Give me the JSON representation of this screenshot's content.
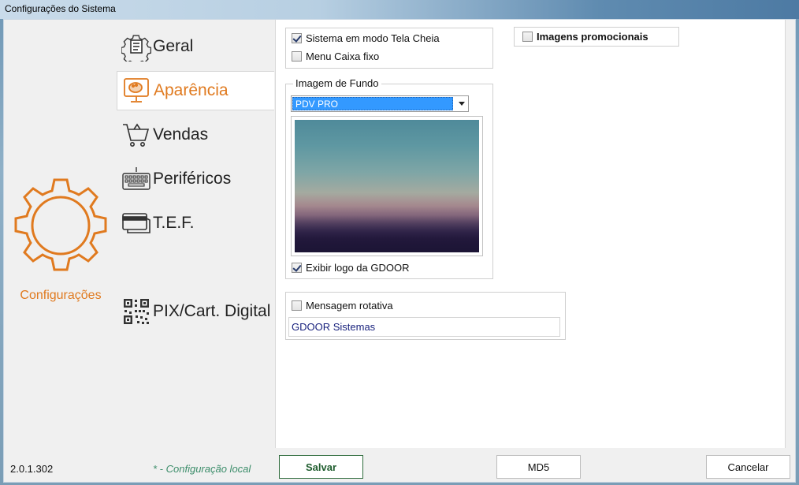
{
  "window": {
    "title": "Configurações do Sistema"
  },
  "sidebar": {
    "brand_label": "Configurações",
    "items": [
      {
        "label": "Geral",
        "icon": "document-gear-icon",
        "active": false
      },
      {
        "label": "Aparência",
        "icon": "monitor-palette-icon",
        "active": true
      },
      {
        "label": "Vendas",
        "icon": "shopping-cart-icon",
        "active": false
      },
      {
        "label": "Periféricos",
        "icon": "keyboard-icon",
        "active": false
      },
      {
        "label": "T.E.F.",
        "icon": "card-terminal-icon",
        "active": false
      },
      {
        "label": "PIX/Cart. Digital",
        "icon": "qr-code-icon",
        "active": false
      }
    ]
  },
  "appearance": {
    "fullscreen": {
      "label": "Sistema em modo Tela Cheia",
      "checked": true
    },
    "fixed_menu": {
      "label": "Menu Caixa fixo",
      "checked": false
    },
    "promo_images": {
      "label": "Imagens promocionais",
      "checked": false
    },
    "background": {
      "legend": "Imagem de Fundo",
      "selected": "PDV PRO",
      "show_logo": {
        "label": "Exibir logo da GDOOR",
        "checked": true
      }
    },
    "rotating_message": {
      "label": "Mensagem rotativa",
      "checked": false,
      "value": "GDOOR Sistemas"
    }
  },
  "footer": {
    "version": "2.0.1.302",
    "local_note": "* - Configuração local",
    "save_label": "Salvar",
    "md5_label": "MD5",
    "cancel_label": "Cancelar"
  },
  "colors": {
    "accent": "#e07a1f",
    "selection": "#3399ff",
    "save_border": "#2e6b3c"
  }
}
